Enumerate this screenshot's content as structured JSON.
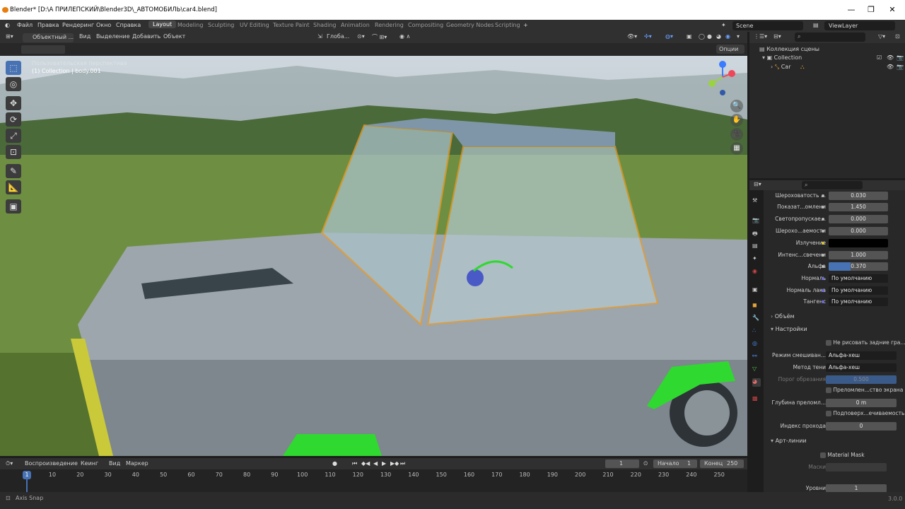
{
  "titlebar": {
    "title": "Blender* [D:\\А ПРИЛЕПСКИЙ\\Blender3D\\_АВТОМОБИЛЬ\\car4.blend]",
    "minimize": "—",
    "maximize": "❐",
    "close": "✕"
  },
  "menu": {
    "items": [
      "Файл",
      "Правка",
      "Рендеринг",
      "Окно",
      "Справка"
    ],
    "workspaces": [
      "Layout",
      "Modeling",
      "Sculpting",
      "UV Editing",
      "Texture Paint",
      "Shading",
      "Animation",
      "Rendering",
      "Compositing",
      "Geometry Nodes",
      "Scripting"
    ],
    "active_workspace": "Layout",
    "add_workspace": "+",
    "scene": "Scene",
    "view_layer": "ViewLayer"
  },
  "viewport_header": {
    "mode": "Объектный ...",
    "menus": [
      "Вид",
      "Выделение",
      "Добавить",
      "Объект"
    ],
    "transform": "Глоба...",
    "options": "Опции"
  },
  "viewport": {
    "view_name": "Пользовательская перспектива",
    "collection_line": "(1) Collection | body.001"
  },
  "outliner": {
    "root": "Коллекция сцены",
    "items": [
      {
        "label": "Collection",
        "depth": 1
      },
      {
        "label": "Car",
        "depth": 2
      }
    ]
  },
  "properties": {
    "rows": [
      {
        "label": "Шероховатость ...",
        "value": "0.030"
      },
      {
        "label": "Показат...омлени",
        "value": "1.450"
      },
      {
        "label": "Светопропускае...",
        "value": "0.000"
      },
      {
        "label": "Шерохо...аемости",
        "value": "0.000"
      },
      {
        "label": "Излучение",
        "value": ""
      },
      {
        "label": "Интенс...свечени",
        "value": "1.000"
      },
      {
        "label": "Альфа",
        "value": "0.370",
        "fill": 0.37
      },
      {
        "label": "Нормаль",
        "value": "По умолчанию"
      },
      {
        "label": "Нормаль лака",
        "value": "По умолчанию"
      },
      {
        "label": "Тангенс",
        "value": "По умолчанию"
      }
    ],
    "panels": {
      "volume": "Объём",
      "settings": "Настройки",
      "line_art": "Арт-линии"
    },
    "settings": {
      "backface_label": "Не рисовать задние гра...",
      "blend_label": "Режим смешиван...",
      "blend_value": "Альфа-хеш",
      "shadow_label": "Метод тени",
      "shadow_value": "Альфа-хеш",
      "clip_label": "Порог обрезания",
      "clip_value": "0.500",
      "refraction_label": "Преломлен...ство экрана",
      "refraction_depth_label": "Глубина преломл...",
      "refraction_depth_value": "0 m",
      "subsurface_label": "Подповерх...ечиваемость",
      "pass_index_label": "Индекс прохода",
      "pass_index_value": "0"
    },
    "line_art": {
      "material_mask": "Material Mask",
      "masks_label": "Маски",
      "levels_label": "Уровни",
      "levels_value": "1"
    }
  },
  "timeline": {
    "menus": [
      "Воспроизведение",
      "Кеинг",
      "Вид",
      "Маркер"
    ],
    "current_frame": "1",
    "start_label": "Начало",
    "start_value": "1",
    "end_label": "Конец",
    "end_value": "250",
    "ticks": [
      "10",
      "20",
      "30",
      "40",
      "50",
      "60",
      "70",
      "80",
      "90",
      "100",
      "110",
      "120",
      "130",
      "140",
      "150",
      "160",
      "170",
      "180",
      "190",
      "200",
      "210",
      "220",
      "230",
      "240",
      "250"
    ],
    "cursor": "1"
  },
  "status": {
    "left": "Axis Snap",
    "version": "3.0.0"
  },
  "colors": {
    "accent": "#4772b3",
    "selection": "#e8820d",
    "wheel": "#2fd92f"
  }
}
